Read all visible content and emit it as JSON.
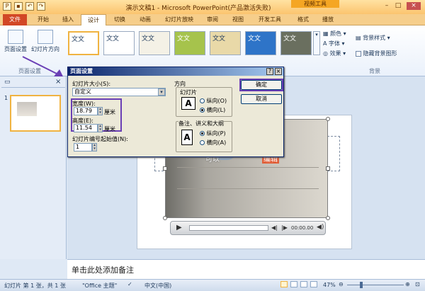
{
  "titlebar": {
    "title": "演示文稿1 - Microsoft PowerPoint(产品激活失败)",
    "video_tools": "视频工具"
  },
  "tabs": [
    "文件",
    "开始",
    "插入",
    "设计",
    "切换",
    "动画",
    "幻灯片放映",
    "审阅",
    "视图",
    "开发工具",
    "格式",
    "播放"
  ],
  "ribbon": {
    "page_setup": "页面设置",
    "slide_orientation": "幻灯片方向",
    "group_page_setup": "页面设置",
    "theme_sample": "文文",
    "colors": "颜色",
    "fonts": "字体",
    "effects": "效果",
    "bg_styles": "背景样式",
    "hide_bg": "隐藏背景图形",
    "group_background": "背景"
  },
  "dialog": {
    "title": "页面设置",
    "help": "?",
    "close": "×",
    "size_label": "幻灯片大小(S):",
    "size_value": "自定义",
    "width_label": "宽度(W):",
    "width_value": "18.79",
    "width_unit": "厘米",
    "height_label": "高度(E):",
    "height_value": "11.54",
    "height_unit": "厘米",
    "numbering_label": "幻灯片编号起始值(N):",
    "numbering_value": "1",
    "orientation_title": "方向",
    "slides_title": "幻灯片",
    "portrait": "纵向(O)",
    "landscape": "横向(L)",
    "notes_title": "备注、讲义和大纲",
    "notes_portrait": "纵向(P)",
    "notes_landscape": "横向(A)",
    "ok": "确定",
    "cancel": "取消"
  },
  "slide": {
    "text1": "可以",
    "text2": "编辑"
  },
  "player": {
    "time": "00:00.00"
  },
  "notes_placeholder": "单击此处添加备注",
  "status": {
    "slide_info": "幻灯片 第 1 张，共 1 张",
    "theme": "\"Office 主题\"",
    "language": "中文(中国)",
    "zoom": "47%"
  },
  "colors": {
    "accent": "#6a3fb5",
    "file_tab": "#d24726"
  }
}
